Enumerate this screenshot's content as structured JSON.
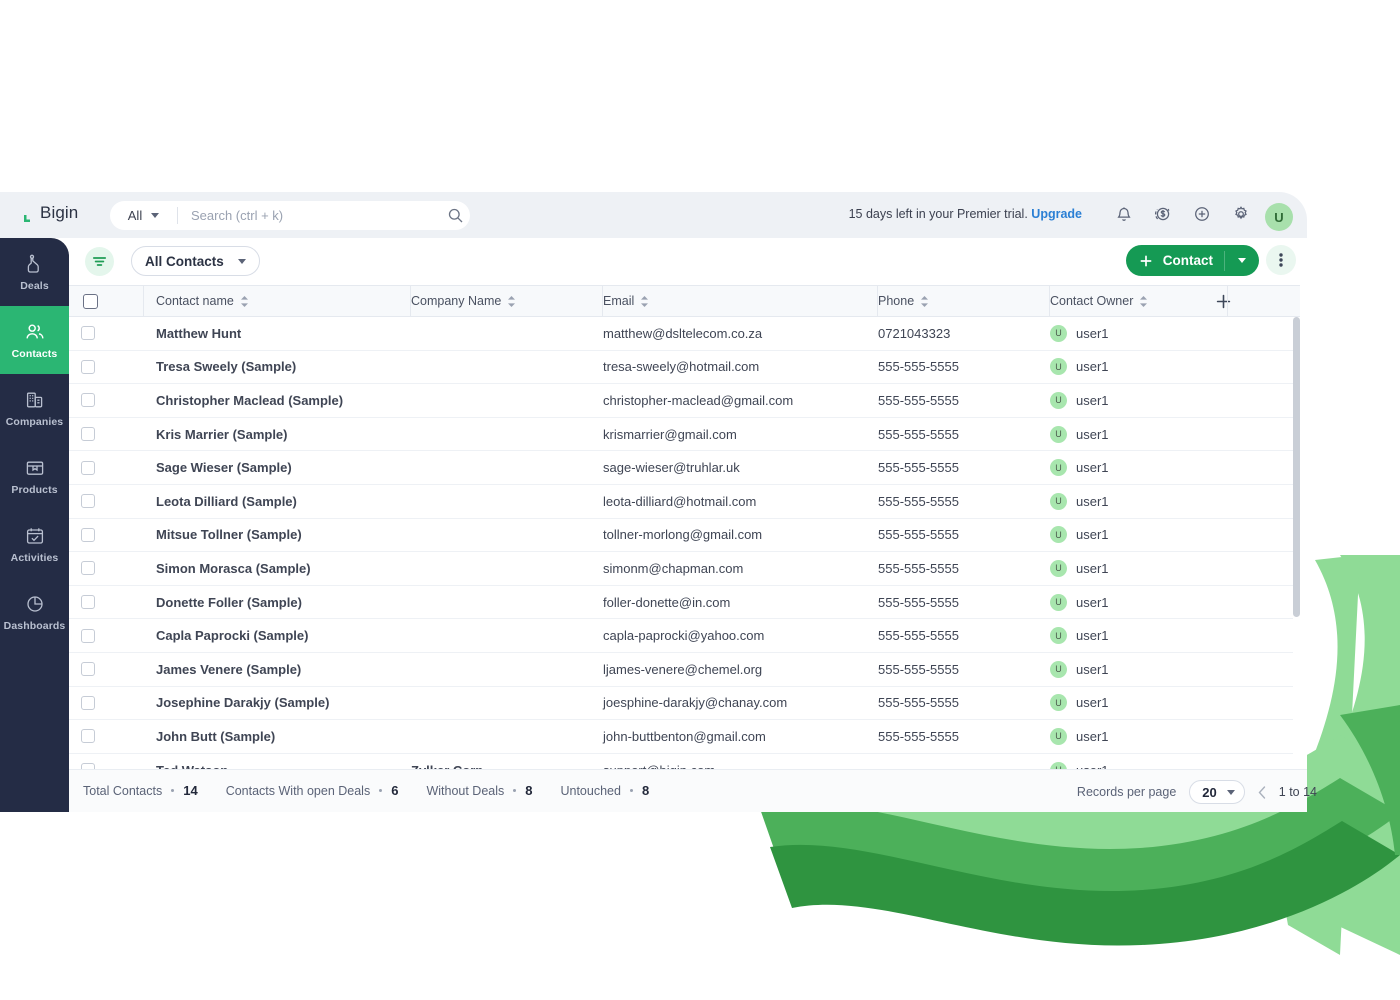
{
  "brand": {
    "name": "Bigin",
    "logo_icon": "bigin-logo-icon"
  },
  "header": {
    "scope_label": "All",
    "scope_caret_icon": "chevron-down-icon",
    "search_placeholder": "Search (ctrl + k)",
    "search_value": "",
    "search_icon": "search-icon",
    "trial_text": "15 days left in your Premier trial.",
    "upgrade_label": "Upgrade",
    "icons": [
      "bell-icon",
      "dollar-circle-icon",
      "plus-circle-icon",
      "gear-icon"
    ],
    "avatar_initial": "U"
  },
  "sidebar": {
    "items": [
      {
        "label": "Deals",
        "icon": "deals-icon",
        "active": false
      },
      {
        "label": "Contacts",
        "icon": "contacts-icon",
        "active": true
      },
      {
        "label": "Companies",
        "icon": "companies-icon",
        "active": false
      },
      {
        "label": "Products",
        "icon": "products-icon",
        "active": false
      },
      {
        "label": "Activities",
        "icon": "activities-icon",
        "active": false
      },
      {
        "label": "Dashboards",
        "icon": "dashboards-icon",
        "active": false
      }
    ],
    "active_color": "#2bb673",
    "bg_color": "#242c45"
  },
  "toolbar": {
    "filter_icon": "filter-icon",
    "view_label": "All Contacts",
    "view_caret_icon": "chevron-down-icon",
    "add_label": "Contact",
    "add_plus_icon": "plus-icon",
    "add_caret_icon": "chevron-down-icon",
    "add_color": "#159a54",
    "kebab_icon": "more-vertical-icon"
  },
  "table": {
    "columns": [
      {
        "key": "name",
        "label": "Contact name",
        "sort_icon": "sort-icon"
      },
      {
        "key": "comp",
        "label": "Company Name",
        "sort_icon": "sort-icon"
      },
      {
        "key": "mail",
        "label": "Email",
        "sort_icon": "sort-icon"
      },
      {
        "key": "phone",
        "label": "Phone",
        "sort_icon": "sort-icon"
      },
      {
        "key": "owner",
        "label": "Contact Owner",
        "sort_icon": "sort-icon"
      }
    ],
    "add_column_icon": "plus-icon",
    "owner_avatar_initial": "U",
    "rows": [
      {
        "name": "Matthew Hunt",
        "comp": "",
        "mail": "matthew@dsltelecom.co.za",
        "phone": "0721043323",
        "owner": "user1"
      },
      {
        "name": "Tresa Sweely (Sample)",
        "comp": "",
        "mail": "tresa-sweely@hotmail.com",
        "phone": "555-555-5555",
        "owner": "user1"
      },
      {
        "name": "Christopher Maclead (Sample)",
        "comp": "",
        "mail": "christopher-maclead@gmail.com",
        "phone": "555-555-5555",
        "owner": "user1"
      },
      {
        "name": "Kris Marrier (Sample)",
        "comp": "",
        "mail": "krismarrier@gmail.com",
        "phone": "555-555-5555",
        "owner": "user1"
      },
      {
        "name": "Sage Wieser (Sample)",
        "comp": "",
        "mail": "sage-wieser@truhlar.uk",
        "phone": "555-555-5555",
        "owner": "user1"
      },
      {
        "name": "Leota Dilliard (Sample)",
        "comp": "",
        "mail": "leota-dilliard@hotmail.com",
        "phone": "555-555-5555",
        "owner": "user1"
      },
      {
        "name": "Mitsue Tollner (Sample)",
        "comp": "",
        "mail": "tollner-morlong@gmail.com",
        "phone": "555-555-5555",
        "owner": "user1"
      },
      {
        "name": "Simon Morasca (Sample)",
        "comp": "",
        "mail": "simonm@chapman.com",
        "phone": "555-555-5555",
        "owner": "user1"
      },
      {
        "name": "Donette Foller (Sample)",
        "comp": "",
        "mail": "foller-donette@in.com",
        "phone": "555-555-5555",
        "owner": "user1"
      },
      {
        "name": "Capla Paprocki (Sample)",
        "comp": "",
        "mail": "capla-paprocki@yahoo.com",
        "phone": "555-555-5555",
        "owner": "user1"
      },
      {
        "name": "James Venere (Sample)",
        "comp": "",
        "mail": "ljames-venere@chemel.org",
        "phone": "555-555-5555",
        "owner": "user1"
      },
      {
        "name": "Josephine Darakjy (Sample)",
        "comp": "",
        "mail": "joesphine-darakjy@chanay.com",
        "phone": "555-555-5555",
        "owner": "user1"
      },
      {
        "name": "John Butt (Sample)",
        "comp": "",
        "mail": "john-buttbenton@gmail.com",
        "phone": "555-555-5555",
        "owner": "user1"
      },
      {
        "name": "Ted Watson",
        "comp": "Zylker Corp",
        "mail": "support@bigin.com",
        "phone": "",
        "owner": "user1"
      }
    ]
  },
  "footer": {
    "stats": [
      {
        "label": "Total Contacts",
        "value": "14"
      },
      {
        "label": "Contacts With open Deals",
        "value": "6"
      },
      {
        "label": "Without Deals",
        "value": "8"
      },
      {
        "label": "Untouched",
        "value": "8"
      }
    ],
    "records_label": "Records per page",
    "records_value": "20",
    "records_caret_icon": "chevron-down-icon",
    "prev_icon": "chevron-left-icon",
    "range_label": "1 to 14"
  },
  "decor": {
    "wave_light": "#8fdb96",
    "wave_mid": "#4cb05a",
    "wave_dark": "#2f9440"
  }
}
